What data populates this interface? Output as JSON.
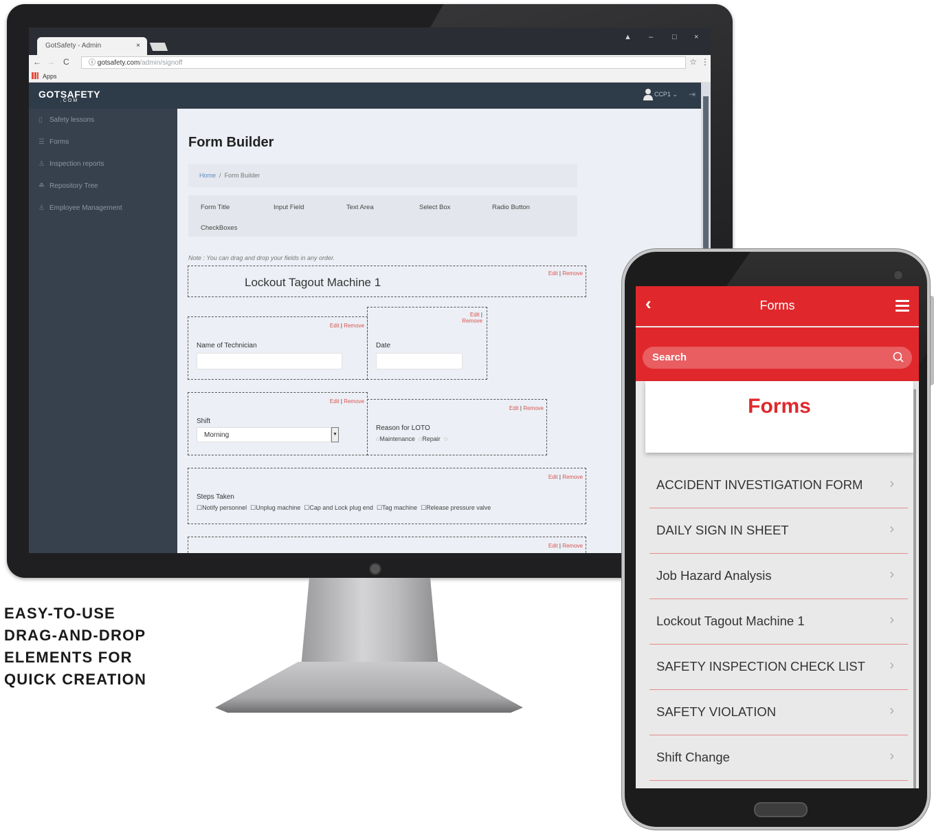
{
  "browser": {
    "tab_title": "GotSafety - Admin",
    "url_host": "gotsafety.com",
    "url_path": "/admin/signoff",
    "apps_label": "Apps"
  },
  "app": {
    "logo": "GOTSAFETY",
    "logo_sub": ".COM",
    "user": "CCP1",
    "sidebar": [
      {
        "label": "Safety lessons",
        "icon": "book-icon"
      },
      {
        "label": "Forms",
        "icon": "list-icon"
      },
      {
        "label": "Inspection reports",
        "icon": "person-icon"
      },
      {
        "label": "Repository Tree",
        "icon": "tree-icon"
      },
      {
        "label": "Employee Management",
        "icon": "person-icon"
      }
    ],
    "page_title": "Form Builder",
    "breadcrumb": {
      "home": "Home",
      "separator": "/",
      "current": "Form Builder"
    },
    "tools": [
      "Form Title",
      "Input Field",
      "Text Area",
      "Select Box",
      "Radio Button",
      "CheckBoxes"
    ],
    "note": "Note : You can drag and drop your fields in any order.",
    "edit_label": "Edit",
    "remove_label": "Remove",
    "form": {
      "title": "Lockout Tagout Machine 1",
      "technician_label": "Name of Technician",
      "date_label": "Date",
      "shift_label": "Shift",
      "shift_value": "Morning",
      "reason_label": "Reason for LOTO",
      "reason_options": [
        "Maintenance",
        "Repair"
      ],
      "steps_label": "Steps Taken",
      "steps_options": [
        "Notify personnel",
        "Unplug machine",
        "Cap and Lock plug end",
        "Tag machine",
        "Release pressure valve"
      ]
    }
  },
  "phone": {
    "header_title": "Forms",
    "search_placeholder": "Search",
    "card_title": "Forms",
    "items": [
      "ACCIDENT INVESTIGATION FORM",
      "DAILY SIGN IN SHEET",
      "Job Hazard Analysis",
      "Lockout Tagout Machine 1",
      "SAFETY INSPECTION CHECK LIST",
      "SAFETY VIOLATION",
      "Shift Change"
    ]
  },
  "caption": [
    "EASY-TO-USE",
    "DRAG-AND-DROP",
    "ELEMENTS FOR",
    "QUICK CREATION"
  ],
  "colors": {
    "brand_red": "#e0282c",
    "sidebar": "#37414d",
    "header": "#2e3b49"
  }
}
